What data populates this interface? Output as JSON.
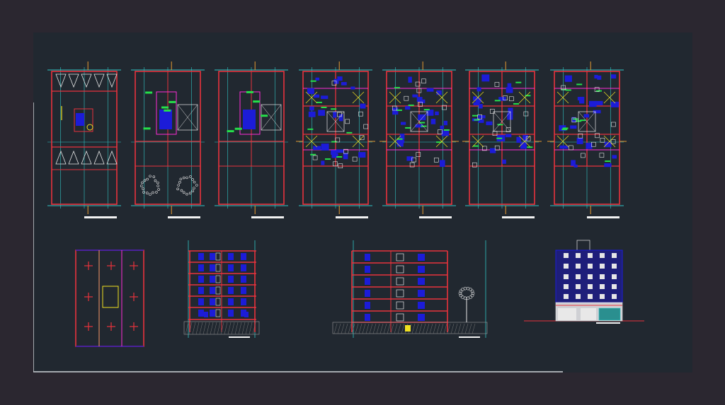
{
  "window": {
    "title": ""
  },
  "colors": {
    "viewport_bg": "#212830",
    "frame_bg": "#2b2730",
    "wall": "#e8323c",
    "grid": "#31c6c6",
    "furniture": "#1c1cd8",
    "accent": "#ff2bd6",
    "green": "#25e04a",
    "yellow": "#f0e020",
    "white": "#e6e6e6",
    "scale_bar": "#f2f2f2"
  },
  "sheets": {
    "plans": [
      {
        "id": "basement-parking-plan"
      },
      {
        "id": "ground-floor-plan"
      },
      {
        "id": "mezzanine-plan"
      },
      {
        "id": "typical-floor-plan-a"
      },
      {
        "id": "typical-floor-plan-b"
      },
      {
        "id": "typical-floor-plan-c"
      },
      {
        "id": "roof-level-plan"
      }
    ],
    "lower": [
      {
        "id": "roof-plan"
      },
      {
        "id": "section-a"
      },
      {
        "id": "section-b"
      },
      {
        "id": "front-elevation"
      }
    ]
  }
}
